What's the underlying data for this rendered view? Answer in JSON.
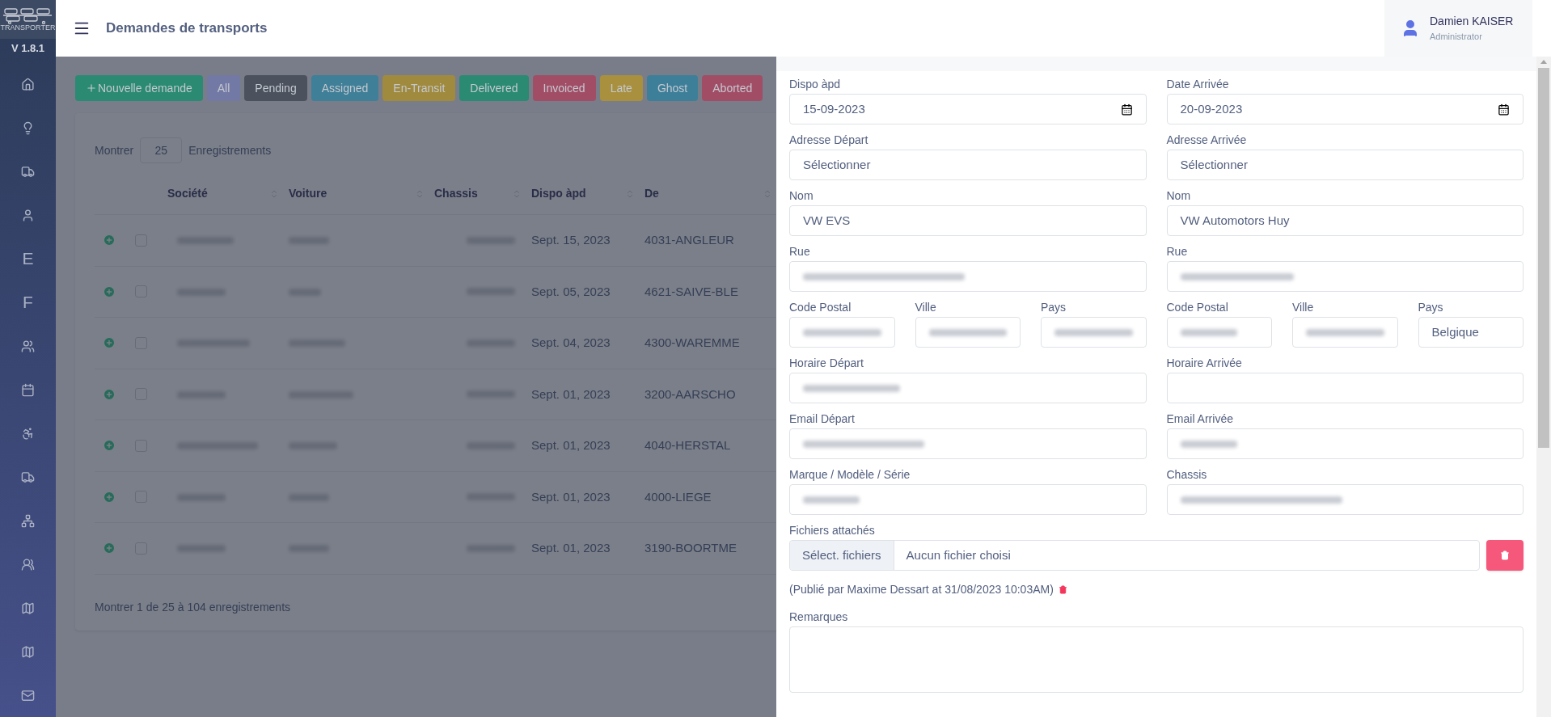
{
  "sidebar": {
    "logo_text": "TRANSPORTER",
    "version": "V 1.8.1",
    "items": [
      {
        "kind": "icon"
      },
      {
        "kind": "icon"
      },
      {
        "kind": "icon"
      },
      {
        "kind": "icon"
      },
      {
        "kind": "letter",
        "label": "E"
      },
      {
        "kind": "letter",
        "label": "F"
      },
      {
        "kind": "icon"
      },
      {
        "kind": "icon"
      },
      {
        "kind": "icon"
      },
      {
        "kind": "icon"
      },
      {
        "kind": "icon"
      },
      {
        "kind": "icon"
      },
      {
        "kind": "icon"
      },
      {
        "kind": "icon"
      },
      {
        "kind": "icon"
      }
    ]
  },
  "header": {
    "title": "Demandes de transports",
    "user_name": "Damien KAISER",
    "user_role": "Administrator"
  },
  "new_button": {
    "label": "Nouvelle demande"
  },
  "filters": [
    {
      "label": "All",
      "color": "#7379a5"
    },
    {
      "label": "Pending",
      "color": "#4b525e"
    },
    {
      "label": "Assigned",
      "color": "#3f7f97"
    },
    {
      "label": "En-Transit",
      "color": "#a08a3d"
    },
    {
      "label": "Delivered",
      "color": "#2a8a72"
    },
    {
      "label": "Invoiced",
      "color": "#a24d66"
    },
    {
      "label": "Late",
      "color": "#a8903f"
    },
    {
      "label": "Ghost",
      "color": "#3d7f99"
    },
    {
      "label": "Aborted",
      "color": "#a24d66"
    }
  ],
  "table": {
    "length_before": "Montrer",
    "length_value": "25",
    "length_after": "Enregistrements",
    "columns": [
      "Société",
      "Voiture",
      "Chassis",
      "Dispo àpd",
      "De"
    ],
    "rows": [
      {
        "checked": false,
        "dispo": "Sept. 15, 2023",
        "de": "4031-ANGLEUR"
      },
      {
        "checked": false,
        "dispo": "Sept. 05, 2023",
        "de": "4621-SAIVE-BLE"
      },
      {
        "checked": false,
        "dispo": "Sept. 04, 2023",
        "de": "4300-WAREMME"
      },
      {
        "checked": false,
        "dispo": "Sept. 01, 2023",
        "de": "3200-AARSCHO"
      },
      {
        "checked": false,
        "dispo": "Sept. 01, 2023",
        "de": "4040-HERSTAL"
      },
      {
        "checked": false,
        "dispo": "Sept. 01, 2023",
        "de": "4000-LIEGE"
      },
      {
        "checked": false,
        "dispo": "Sept. 01, 2023",
        "de": "3190-BOORTME"
      }
    ],
    "info": "Montrer 1 de 25 à 104 enregistrements"
  },
  "form": {
    "rows": [
      [
        {
          "label": "Dispo àpd",
          "kind": "date",
          "value": "15-09-2023"
        },
        {
          "label": "Date Arrivée",
          "kind": "date",
          "value": "20-09-2023"
        }
      ],
      [
        {
          "label": "Adresse Départ",
          "kind": "select",
          "value": "Sélectionner"
        },
        {
          "label": "Adresse Arrivée",
          "kind": "select",
          "value": "Sélectionner"
        }
      ],
      [
        {
          "label": "Nom",
          "kind": "text",
          "value": "VW EVS"
        },
        {
          "label": "Nom",
          "kind": "text",
          "value": "VW Automotors Huy"
        }
      ],
      [
        {
          "label": "Rue",
          "kind": "redacted"
        },
        {
          "label": "Rue",
          "kind": "redacted"
        }
      ],
      [
        {
          "label": "Code Postal",
          "kind": "redacted"
        },
        {
          "label": "Ville",
          "kind": "redacted"
        },
        {
          "label": "Pays",
          "kind": "redacted"
        },
        {
          "label": "Code Postal",
          "kind": "redacted"
        },
        {
          "label": "Ville",
          "kind": "redacted"
        },
        {
          "label": "Pays",
          "kind": "text",
          "value": "Belgique"
        }
      ],
      [
        {
          "label": "Horaire Départ",
          "kind": "redacted"
        },
        {
          "label": "Horaire Arrivée",
          "kind": "text"
        }
      ],
      [
        {
          "label": "Email Départ",
          "kind": "redacted"
        },
        {
          "label": "Email Arrivée",
          "kind": "redacted"
        }
      ],
      [
        {
          "label": "Marque / Modèle / Série",
          "kind": "redacted"
        },
        {
          "label": "Chassis",
          "kind": "redacted"
        }
      ]
    ],
    "files_label": "Fichiers attachés",
    "file_button": "Sélect. fichiers",
    "file_status": "Aucun fichier choisi",
    "published": "(Publié par Maxime Dessart at 31/08/2023 10:03AM)",
    "remarks_label": "Remarques"
  }
}
